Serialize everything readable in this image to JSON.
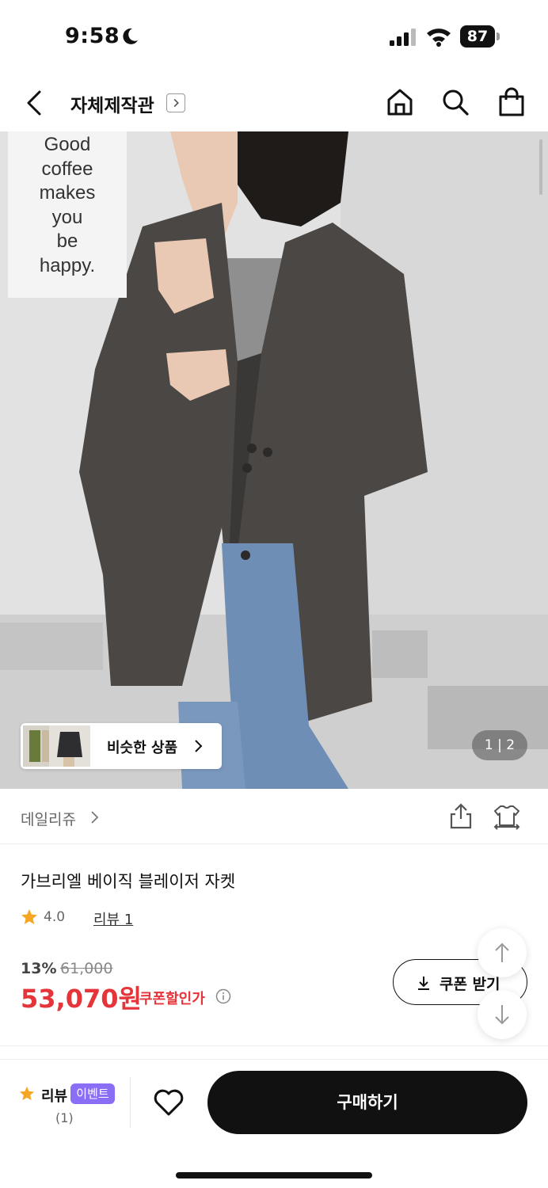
{
  "status_bar": {
    "time": "9:58",
    "battery": "87"
  },
  "top_nav": {
    "title": "자체제작관"
  },
  "hero": {
    "poster_lines": [
      "Good",
      "coffee",
      "makes",
      "you",
      "be",
      "happy."
    ],
    "similar_label": "비슷한 상품",
    "counter": "1 | 2"
  },
  "brand": {
    "name": "데일리쥬"
  },
  "product": {
    "name": "가브리엘 베이직 블레이저 자켓",
    "rating": "4.0",
    "review_link": "리뷰 1",
    "discount_rate": "13%",
    "original_price": "61,000",
    "sale_price": "53,070원",
    "coupon_price_label": "쿠폰할인가",
    "coupon_button": "쿠폰 받기"
  },
  "bottom_bar": {
    "review_label": "리뷰",
    "event_badge": "이벤트",
    "review_count": "(1)",
    "buy_button": "구매하기"
  },
  "colors": {
    "price_red": "#e5343a",
    "event_purple": "#8b6ef5",
    "star_orange": "#f5a623"
  }
}
